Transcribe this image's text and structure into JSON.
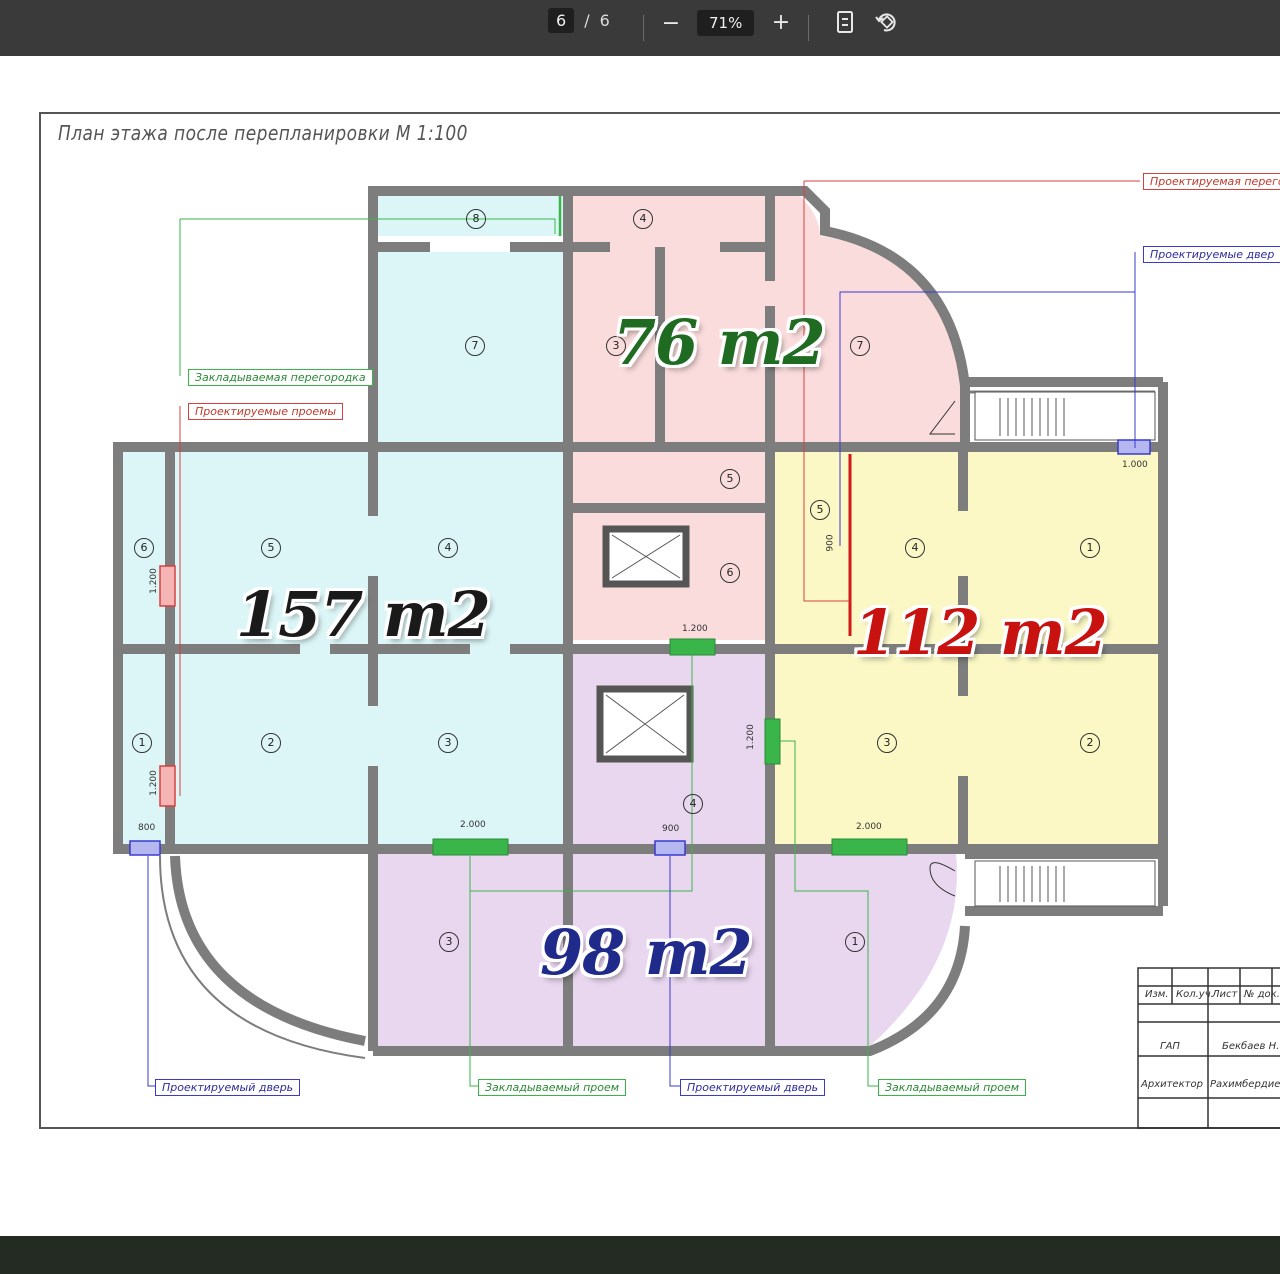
{
  "toolbar": {
    "current_page": "6",
    "separator": "/",
    "total_pages": "6",
    "zoom_out_label": "−",
    "zoom_level": "71%",
    "zoom_in_label": "+",
    "fit_icon": "fit-page-icon",
    "rotate_icon": "rotate-icon"
  },
  "plan": {
    "title": "План этажа после перепланировки М 1:100",
    "labels": {
      "top_right_red": "Проектируемая перегора",
      "top_right_blue": "Проектируемые двер",
      "left_green": "Закладываемая перегородка",
      "left_red": "Проектируемые проемы",
      "bottom_blue_1": "Проектируемый дверь",
      "bottom_green_1": "Закладываемый проем",
      "bottom_blue_2": "Проектируемый дверь",
      "bottom_green_2": "Закладываемый проем"
    },
    "dimensions": {
      "d1": "1.000",
      "d2": "1.200",
      "d3": "1.200",
      "d4": "800",
      "d5": "2.000",
      "d6": "900",
      "d7": "2.000",
      "d8": "1.200",
      "d9": "1.200",
      "d10": "900"
    },
    "areas": {
      "pink": "76 m2",
      "cyan": "157 m2",
      "yellow": "112 m2",
      "purple": "98 m2"
    },
    "area_colors": {
      "pink": "#1f6b22",
      "cyan": "#1a1a1a",
      "yellow": "#c8120f",
      "purple": "#1f2a8a"
    },
    "room_numbers": {
      "c8": "8",
      "c7": "7",
      "c5": "5",
      "c4": "4",
      "c6": "6",
      "c2": "2",
      "c3": "3",
      "c1": "1",
      "p4": "4",
      "p3": "3",
      "p7": "7",
      "p5": "5",
      "p6": "6",
      "y5": "5",
      "y4": "4",
      "y1": "1",
      "y3": "3",
      "y2": "2",
      "v4": "4",
      "v3": "3",
      "v1": "1"
    },
    "stamp": {
      "col1": "Изм.",
      "col2": "Кол.уч.",
      "col3": "Лист",
      "col4": "№ док.",
      "row1_role": "ГАП",
      "row1_name": "Бекбаев Н.",
      "row2_role": "Архитектор",
      "row2_name": "Рахимбердиев"
    }
  },
  "colors": {
    "toolbar_bg": "#3a3a3a",
    "cyan_fill": "#dcf6f7",
    "pink_fill": "#fbdcdc",
    "yellow_fill": "#fbf8c6",
    "purple_fill": "#e9d6ef",
    "wall": "#7d7d7d"
  }
}
